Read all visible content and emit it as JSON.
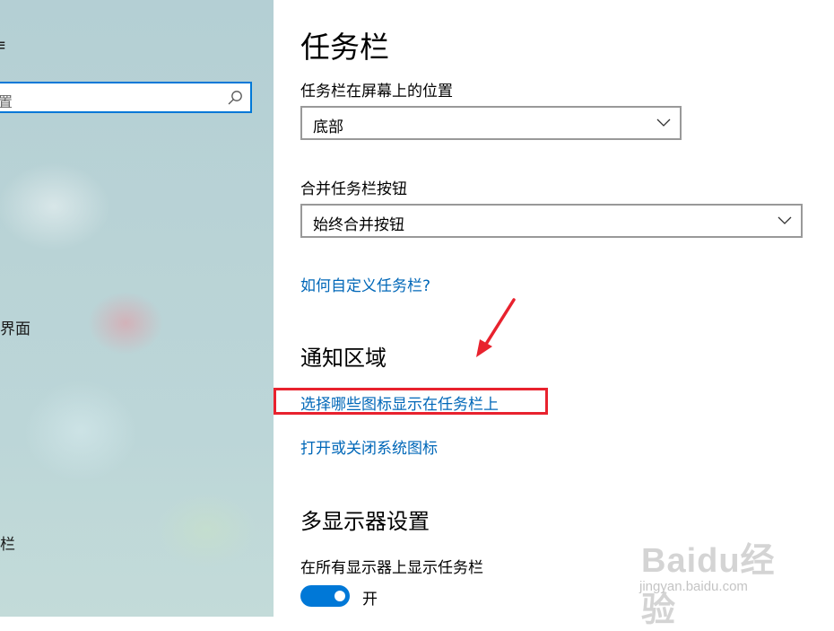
{
  "sidebar": {
    "top_glyph": "≡",
    "search_partial_text": "置",
    "items": [
      {
        "label": "界面"
      },
      {
        "label": "栏"
      }
    ]
  },
  "main": {
    "title": "任务栏",
    "position_label": "任务栏在屏幕上的位置",
    "position_value": "底部",
    "combine_label": "合并任务栏按钮",
    "combine_value": "始终合并按钮",
    "customize_link": "如何自定义任务栏?",
    "notification_title": "通知区域",
    "notification_links": [
      {
        "label": "选择哪些图标显示在任务栏上"
      },
      {
        "label": "打开或关闭系统图标"
      }
    ],
    "multi_display_title": "多显示器设置",
    "show_all_label": "在所有显示器上显示任务栏",
    "show_all_state": "开",
    "show_all_on": true
  },
  "watermark": {
    "brand": "Baidu经验",
    "url": "jingyan.baidu.com"
  },
  "colors": {
    "accent": "#0078d7",
    "link": "#0067b8",
    "highlight": "#e8222e"
  }
}
